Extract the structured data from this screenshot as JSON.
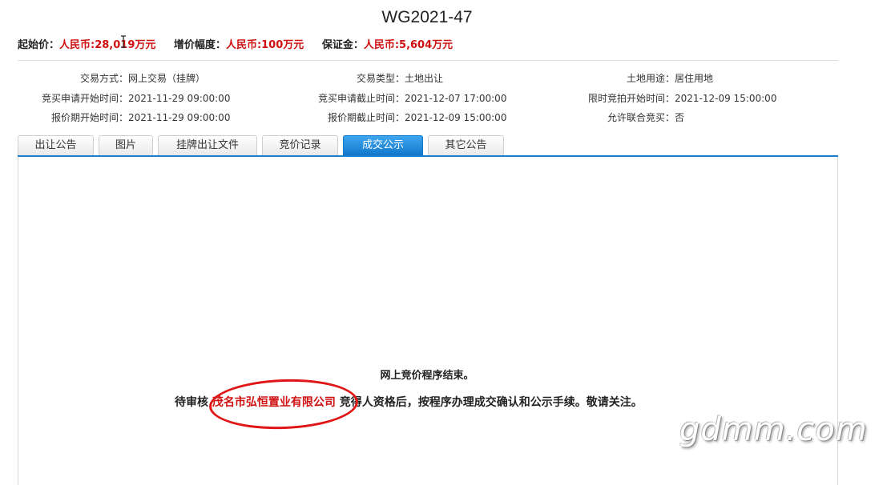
{
  "title": "WG2021-47",
  "prices": [
    {
      "label": "起始价：",
      "value": "人民币:28,019万元"
    },
    {
      "label": "增价幅度：",
      "value": "人民币:100万元"
    },
    {
      "label": "保证金：",
      "value": "人民币:5,604万元"
    }
  ],
  "info": {
    "col1": [
      {
        "label": "交易方式：",
        "value": "网上交易（挂牌）"
      },
      {
        "label": "竞买申请开始时间：",
        "value": "2021-11-29 09:00:00"
      },
      {
        "label": "报价期开始时间：",
        "value": "2021-11-29 09:00:00"
      }
    ],
    "col2": [
      {
        "label": "交易类型：",
        "value": "土地出让"
      },
      {
        "label": "竞买申请截止时间：",
        "value": "2021-12-07 17:00:00"
      },
      {
        "label": "报价期截止时间：",
        "value": "2021-12-09 15:00:00"
      }
    ],
    "col3": [
      {
        "label": "土地用途：",
        "value": "居住用地"
      },
      {
        "label": "限时竞拍开始时间：",
        "value": "2021-12-09 15:00:00"
      },
      {
        "label": "允许联合竞买：",
        "value": "否"
      }
    ]
  },
  "tabs": [
    {
      "label": "出让公告",
      "active": false
    },
    {
      "label": "图片",
      "active": false
    },
    {
      "label": "挂牌出让文件",
      "active": false
    },
    {
      "label": "竞价记录",
      "active": false
    },
    {
      "label": "成交公示",
      "active": true
    },
    {
      "label": "其它公告",
      "active": false
    }
  ],
  "notice": {
    "line1": "网上竞价程序结束。",
    "line2_prefix": "待审核",
    "company": "茂名市弘恒置业有限公司",
    "line2_suffix": "竞得人资格后，按程序办理成交确认和公示手续。敬请关注。"
  },
  "watermark": "gdmm.com",
  "colors": {
    "accent": "#1a7fcf",
    "highlight": "#d01010"
  }
}
